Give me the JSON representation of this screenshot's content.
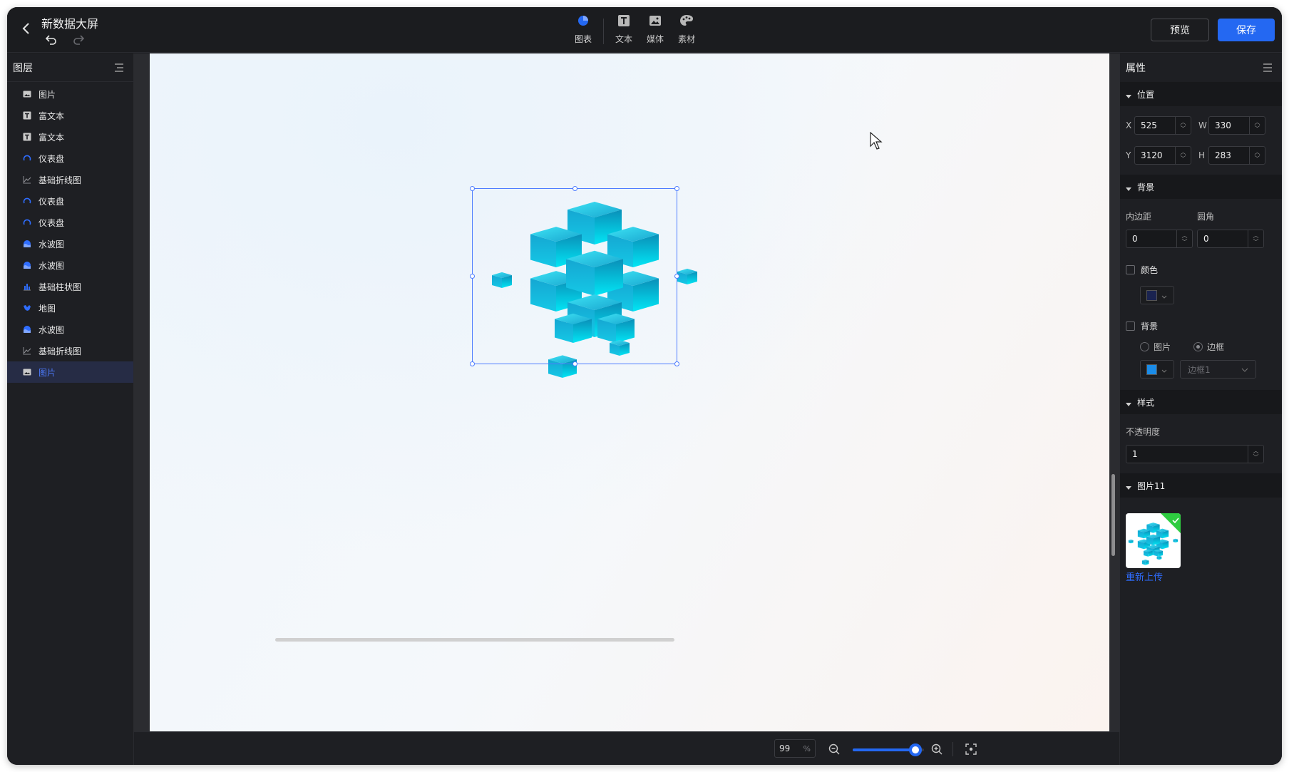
{
  "app": {
    "title": "新数据大屏"
  },
  "toolbar": {
    "items": [
      {
        "label": "图表",
        "icon": "pie-chart-icon"
      },
      {
        "label": "文本",
        "icon": "text-icon"
      },
      {
        "label": "媒体",
        "icon": "image-icon"
      },
      {
        "label": "素材",
        "icon": "palette-icon"
      }
    ],
    "preview_label": "预览",
    "save_label": "保存"
  },
  "layers_panel": {
    "title": "图层",
    "items": [
      {
        "label": "图片",
        "icon": "image-icon"
      },
      {
        "label": "富文本",
        "icon": "text-icon"
      },
      {
        "label": "富文本",
        "icon": "text-icon"
      },
      {
        "label": "仪表盘",
        "icon": "gauge-icon"
      },
      {
        "label": "基础折线图",
        "icon": "line-chart-icon"
      },
      {
        "label": "仪表盘",
        "icon": "gauge-icon"
      },
      {
        "label": "仪表盘",
        "icon": "gauge-icon"
      },
      {
        "label": "水波图",
        "icon": "liquid-fill-icon"
      },
      {
        "label": "水波图",
        "icon": "liquid-fill-icon"
      },
      {
        "label": "基础柱状图",
        "icon": "bar-chart-icon"
      },
      {
        "label": "地图",
        "icon": "map-icon"
      },
      {
        "label": "水波图",
        "icon": "liquid-fill-icon"
      },
      {
        "label": "基础折线图",
        "icon": "line-chart-icon"
      },
      {
        "label": "图片",
        "icon": "image-icon",
        "selected": true
      }
    ]
  },
  "properties_panel": {
    "title": "属性",
    "position": {
      "section_label": "位置",
      "x_label": "X",
      "x_value": "525",
      "w_label": "W",
      "w_value": "330",
      "y_label": "Y",
      "y_value": "3120",
      "h_label": "H",
      "h_value": "283"
    },
    "background": {
      "section_label": "背景",
      "padding_label": "内边距",
      "padding_value": "0",
      "radius_label": "圆角",
      "radius_value": "0",
      "color_label": "颜色",
      "color_swatch": "#1a2350",
      "bg_label": "背景",
      "radio_image": "图片",
      "radio_border": "边框",
      "bg_swatch": "#1a8ce8",
      "border_select_placeholder": "边框1"
    },
    "style": {
      "section_label": "样式",
      "opacity_label": "不透明度",
      "opacity_value": "1"
    },
    "image": {
      "section_label": "图片11",
      "reupload_label": "重新上传"
    }
  },
  "zoom": {
    "value": "99",
    "unit": "%",
    "level": 0.88
  },
  "colors": {
    "accent": "#2468f2",
    "cube_light": "#22d6f0",
    "cube_dark": "#0a8fb8"
  }
}
